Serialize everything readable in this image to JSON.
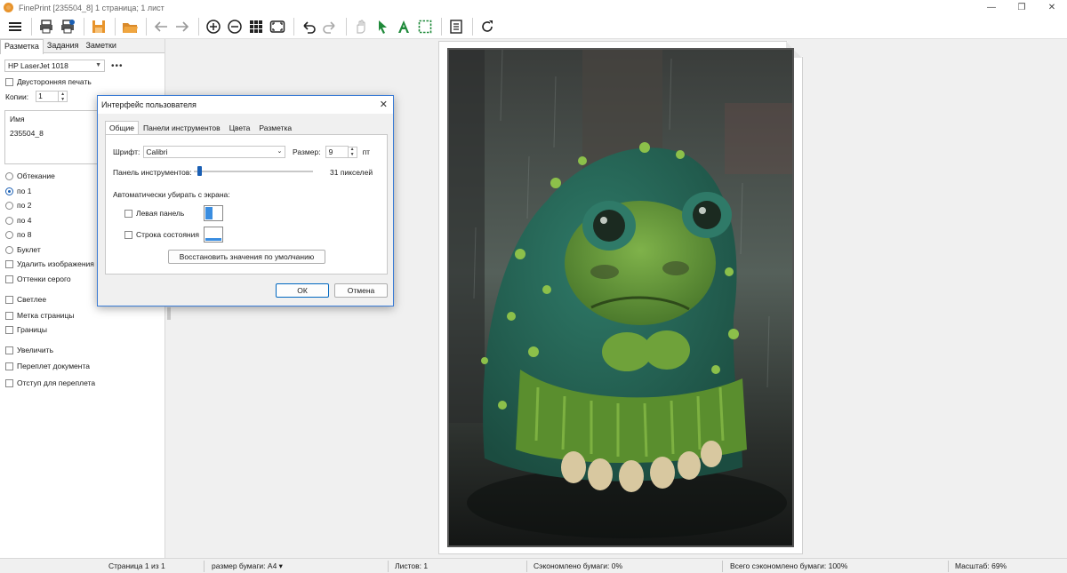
{
  "window": {
    "title": "FinePrint [235504_8] 1 страница; 1 лист",
    "minimize": "—",
    "maximize": "❐",
    "close": "✕"
  },
  "toolbar": {
    "buttons": [
      "menu-icon",
      "print-icon",
      "print-setup-icon",
      "save-icon",
      "open-icon",
      "back-icon",
      "forward-icon",
      "zoom-in-icon",
      "zoom-out-icon",
      "grid-icon",
      "fit-page-icon",
      "undo-icon",
      "redo-icon",
      "hand-icon",
      "pointer-icon",
      "text-icon",
      "select-icon",
      "notes-icon",
      "refresh-icon"
    ]
  },
  "sidebar": {
    "tabs": [
      "Разметка",
      "Задания",
      "Заметки"
    ],
    "active_tab": 0,
    "printer": "HP LaserJet 1018",
    "more": "•••",
    "duplex_label": "Двусторонняя печать",
    "copies_label": "Копии:",
    "copies_value": "1",
    "name_header": "Имя",
    "name_value": "235504_8",
    "options": [
      {
        "type": "radio",
        "label": "Обтекание",
        "checked": false
      },
      {
        "type": "radio",
        "label": "по 1",
        "checked": true
      },
      {
        "type": "radio",
        "label": "по 2",
        "checked": false
      },
      {
        "type": "radio",
        "label": "по 4",
        "checked": false
      },
      {
        "type": "radio",
        "label": "по 8",
        "checked": false
      },
      {
        "type": "radio",
        "label": "Буклет",
        "checked": false
      },
      {
        "type": "check",
        "label": "Удалить изображения",
        "checked": false
      },
      {
        "type": "check",
        "label": "Оттенки серого",
        "checked": false
      },
      {
        "type": "check",
        "label": "Светлее",
        "checked": false
      },
      {
        "type": "check",
        "label": "Метка страницы",
        "checked": false
      },
      {
        "type": "check",
        "label": "Границы",
        "checked": false
      },
      {
        "type": "check",
        "label": "Увеличить",
        "checked": false
      },
      {
        "type": "check",
        "label": "Переплет документа",
        "checked": false
      },
      {
        "type": "check",
        "label": "Отступ для переплета",
        "checked": false
      }
    ]
  },
  "dialog": {
    "title": "Интерфейс пользователя",
    "tabs": [
      "Общие",
      "Панели инструментов",
      "Цвета",
      "Разметка"
    ],
    "active_tab": 0,
    "font_label": "Шрифт:",
    "font_value": "Calibri",
    "size_label": "Размер:",
    "size_value": "9",
    "size_unit": "пт",
    "toolbar_label": "Панель инструментов:",
    "toolbar_value": "31 пикселей",
    "toolbar_slider_fraction": 0.03,
    "autohide_label": "Автоматически убирать с экрана:",
    "left_panel_label": "Левая панель",
    "status_bar_label": "Строка состояния",
    "restore_label": "Восстановить значения по умолчанию",
    "ok_label": "ОК",
    "cancel_label": "Отмена"
  },
  "status": {
    "page": "Страница 1 из 1",
    "paper": "размер бумаги: A4 ▾",
    "sheets": "Листов: 1",
    "saved": "Сэкономлено бумаги: 0%",
    "total_saved": "Всего сэкономлено бумаги: 100%",
    "zoom": "Масштаб: 69%"
  },
  "colors": {
    "accent": "#1a5fb4",
    "dialog_border": "#3a7bd5",
    "print_orange": "#e8942c"
  }
}
